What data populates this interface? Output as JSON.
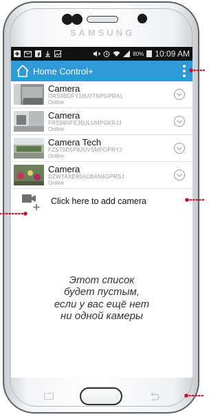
{
  "device": {
    "brand": "SAMSUNG"
  },
  "status_bar": {
    "battery": "80%",
    "time": "10:09 AM"
  },
  "app_bar": {
    "title": "Home Control+"
  },
  "cameras": [
    {
      "name": "Camera",
      "id": "DRS9BDFY18U3TNPGPRA1",
      "status": "Online"
    },
    {
      "name": "Camera",
      "id": "FRS98NFEJ6ULUMPGKRJJ",
      "status": "Online"
    },
    {
      "name": "Camera Tech",
      "id": "FZST9D5P8JUVSMPGPRYJ",
      "status": "Online"
    },
    {
      "name": "Camera",
      "id": "DZWTAXD65AUBAN6GPRSJ",
      "status": "Online"
    }
  ],
  "add_camera": {
    "label": "Click here to add camera"
  },
  "empty_note": {
    "line1": "Этот список",
    "line2": "будет пустым,",
    "line3": "если у вас ещё нет",
    "line4": "ни одной камеры"
  },
  "colors": {
    "app_bar": "#2f9ad6",
    "annotation": "#c8102e"
  }
}
